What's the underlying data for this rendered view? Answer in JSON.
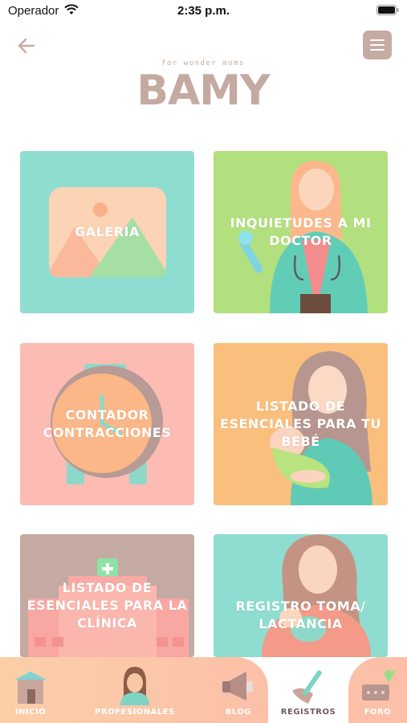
{
  "status_bar": {
    "carrier": "Operador",
    "time": "2:35 p.m."
  },
  "header": {
    "logo_tagline": "for wonder moms",
    "logo_text": "BAMY"
  },
  "colors": {
    "brand": "#c6aba3",
    "tile_teal": "#8fddd0",
    "tile_green": "#b2e07e",
    "tile_pink": "#fcbcb4",
    "tile_orange": "#fbbf7d",
    "tile_mauve": "#c5a9a3",
    "tab_peach": "#fccaa8",
    "tab_active": "#ffffff"
  },
  "tiles": [
    {
      "label": "Galeria",
      "icon": "image-gallery-icon"
    },
    {
      "label": "Inquietudes a mi doctor",
      "icon": "doctor-icon"
    },
    {
      "label": "Contador contracciones",
      "icon": "alarm-clock-icon"
    },
    {
      "label": "Listado de esenciales para tu bebé",
      "icon": "mother-baby-icon"
    },
    {
      "label": "Listado de esenciales para la clínica",
      "icon": "hospital-icon"
    },
    {
      "label": "Registro toma/ lactancia",
      "icon": "breastfeeding-icon"
    }
  ],
  "tabs": [
    {
      "label": "Inicio",
      "icon": "house-icon"
    },
    {
      "label": "Profesionales",
      "icon": "nurse-icon"
    },
    {
      "label": "Blog",
      "icon": "megaphone-icon"
    },
    {
      "label": "Registros",
      "icon": "pen-notebook-icon",
      "active": true
    },
    {
      "label": "Foro",
      "icon": "chat-heart-icon"
    }
  ]
}
